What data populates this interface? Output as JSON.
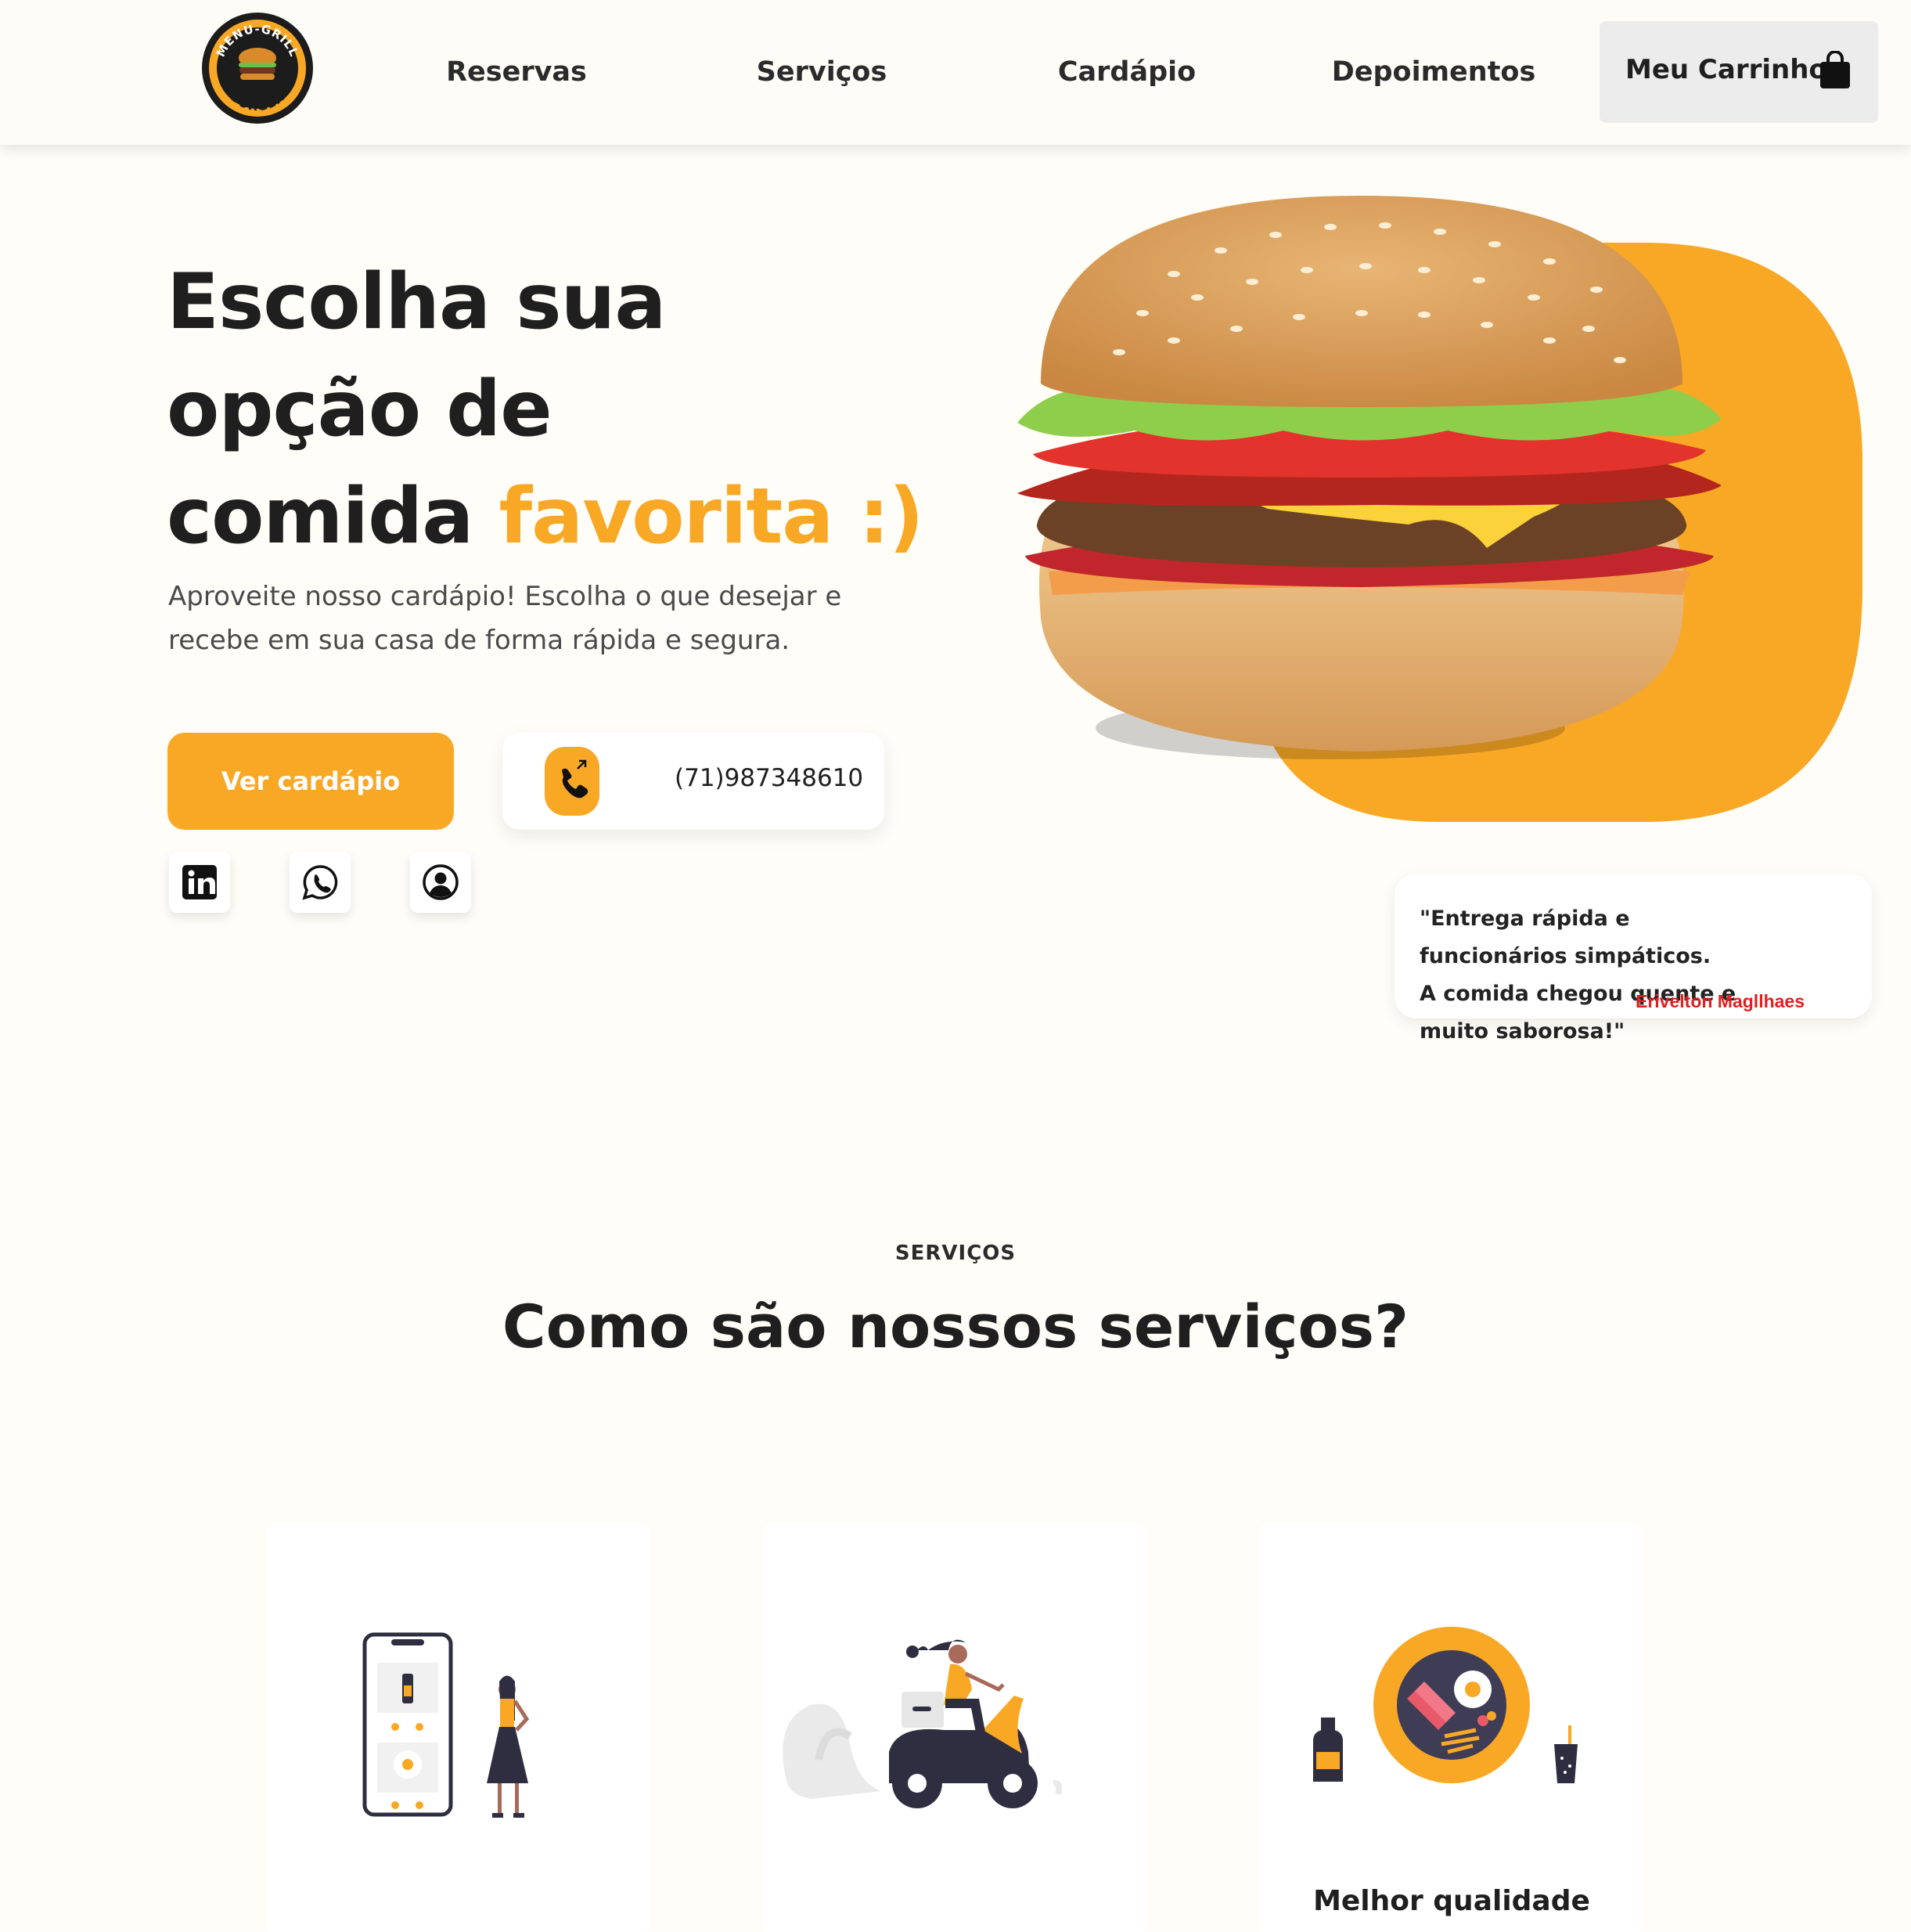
{
  "colors": {
    "accent": "#f9a825",
    "text": "#1f1f1f",
    "author": "#e21f1f"
  },
  "brand": {
    "logo_top": "MENU-GRILL",
    "logo_bottom": "BURGER"
  },
  "nav": {
    "items": [
      "Reservas",
      "Serviços",
      "Cardápio",
      "Depoimentos"
    ],
    "cart_label": "Meu Carrinho",
    "cart_icon": "shopping-bag-icon"
  },
  "hero": {
    "title_line1": "Escolha sua",
    "title_line2": "opção de",
    "title_line3_plain": "comida",
    "title_line3_accent": "favorita :)",
    "subtitle": "Aproveite nosso cardápio! Escolha o que desejar e recebe em sua casa de forma rápida e segura.",
    "cta_label": "Ver cardápio",
    "phone": "(71)987348610",
    "phone_icon": "phone-call-icon",
    "socials": [
      "linkedin-icon",
      "whatsapp-icon",
      "user-profile-icon"
    ]
  },
  "testimonial": {
    "quote": "\"Entrega rápida e funcionários simpáticos.\nA comida chegou quente e muito saborosa!\"",
    "author": "Erivelton Magllhaes"
  },
  "services": {
    "tag": "SERVIÇOS",
    "title": "Como são nossos serviços?",
    "cards": [
      {
        "label": "",
        "illustration": "mobile-order-illustration"
      },
      {
        "label": "",
        "illustration": "scooter-delivery-illustration"
      },
      {
        "label": "Melhor qualidade",
        "illustration": "food-plate-illustration"
      }
    ]
  }
}
